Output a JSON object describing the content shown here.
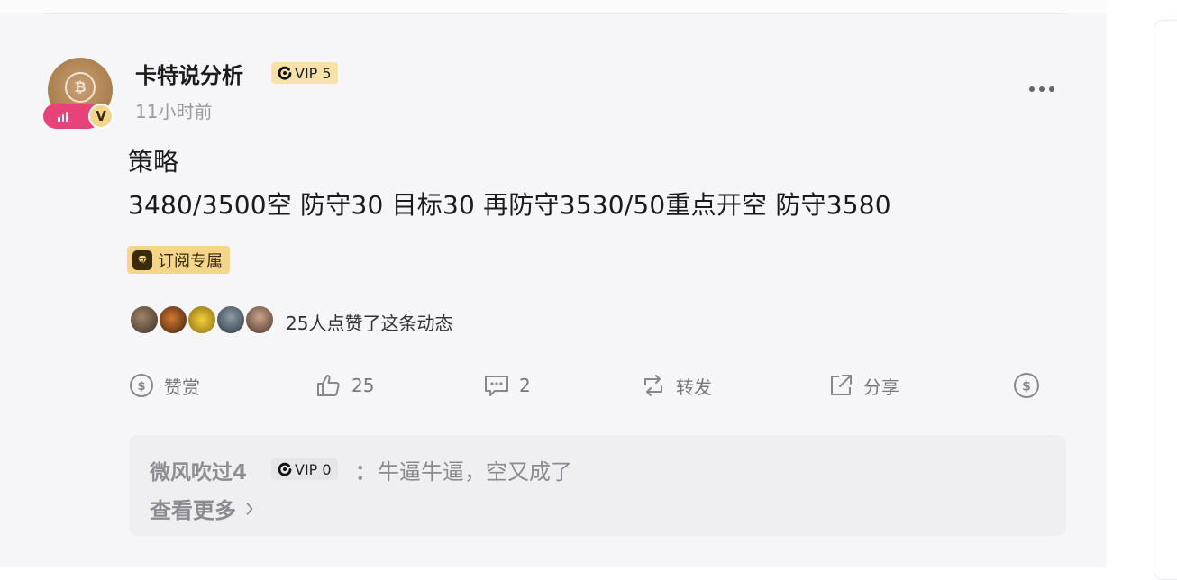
{
  "post": {
    "author": {
      "name": "卡特说分析",
      "vip_label": "VIP 5",
      "verified_label": "V"
    },
    "time": "11小时前",
    "title": "策略",
    "content": "3480/3500空 防守30 目标30 再防守3530/50重点开空 防守3580",
    "subscription_tag": "订阅专属",
    "likes_text": "25人点赞了这条动态",
    "liker_avatars": [
      "avatar-1",
      "avatar-2",
      "avatar-3",
      "avatar-4",
      "avatar-5"
    ]
  },
  "actions": {
    "reward_label": "赞赏",
    "like_count": "25",
    "comment_count": "2",
    "repost_label": "转发",
    "share_label": "分享"
  },
  "comment": {
    "author": "微风吹过4",
    "vip_label": "VIP 0",
    "separator": "：",
    "text": "牛逼牛逼，空又成了",
    "see_more": "查看更多"
  },
  "colors": {
    "vip_gold": "#f8e2a9",
    "subscription_gold": "#f5d588",
    "live_pink": "#e8427a",
    "text_muted": "#9a9aa0"
  }
}
